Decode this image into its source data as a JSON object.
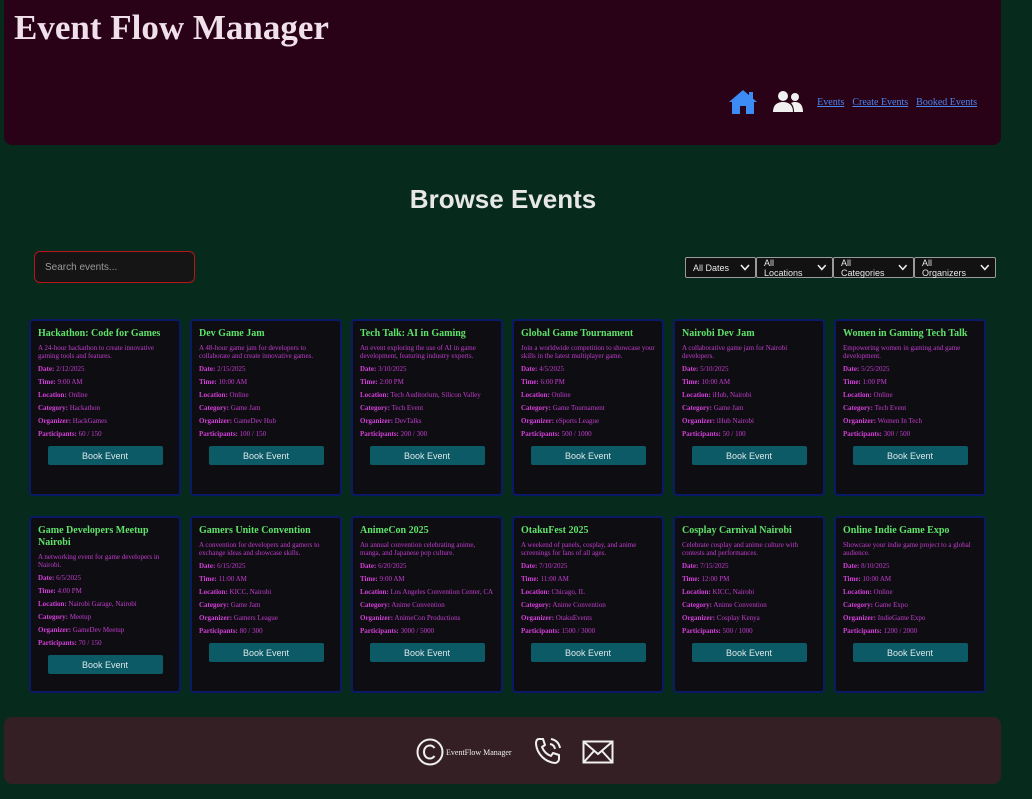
{
  "app_title": "Event Flow Manager",
  "nav": {
    "home_icon": "home-icon",
    "users_icon": "users-icon",
    "links": [
      "Events",
      "Create Events",
      "Booked Events"
    ]
  },
  "page_title": "Browse Events",
  "search": {
    "placeholder": "Search events...",
    "value": ""
  },
  "filters": [
    "All Dates",
    "All Locations",
    "All Categories",
    "All Organizers"
  ],
  "labels": {
    "date": "Date:",
    "time": "Time:",
    "location": "Location:",
    "category": "Category:",
    "organizer": "Organizer:",
    "participants": "Participants:",
    "book_button": "Book Event"
  },
  "events": [
    {
      "title": "Hackathon: Code for Games",
      "description": "A 24-hour hackathon to create innovative gaming tools and features.",
      "date": "2/12/2025",
      "time": "9:00 AM",
      "location": "Online",
      "category": "Hackathon",
      "organizer": "HackGames",
      "participants": "60 / 150"
    },
    {
      "title": "Dev Game Jam",
      "description": "A 48-hour game jam for developers to collaborate and create innovative games.",
      "date": "2/15/2025",
      "time": "10:00 AM",
      "location": "Online",
      "category": "Game Jam",
      "organizer": "GameDev Hub",
      "participants": "100 / 150"
    },
    {
      "title": "Tech Talk: AI in Gaming",
      "description": "An event exploring the use of AI in game development, featuring industry experts.",
      "date": "3/10/2025",
      "time": "2:00 PM",
      "location": "Tech Auditorium, Silicon Valley",
      "category": "Tech Event",
      "organizer": "DevTalks",
      "participants": "200 / 300"
    },
    {
      "title": "Global Game Tournament",
      "description": "Join a worldwide competition to showcase your skills in the latest multiplayer game.",
      "date": "4/5/2025",
      "time": "6:00 PM",
      "location": "Online",
      "category": "Game Tournament",
      "organizer": "eSports League",
      "participants": "500 / 1000"
    },
    {
      "title": "Nairobi Dev Jam",
      "description": "A collaborative game jam for Nairobi developers.",
      "date": "5/10/2025",
      "time": "10:00 AM",
      "location": "iHub, Nairobi",
      "category": "Game Jam",
      "organizer": "iHub Nairobi",
      "participants": "50 / 100"
    },
    {
      "title": "Women in Gaming Tech Talk",
      "description": "Empowering women in gaming and game development.",
      "date": "5/25/2025",
      "time": "1:00 PM",
      "location": "Online",
      "category": "Tech Event",
      "organizer": "Women In Tech",
      "participants": "300 / 500"
    },
    {
      "title": "Game Developers Meetup Nairobi",
      "description": "A networking event for game developers in Nairobi.",
      "date": "6/5/2025",
      "time": "4:00 PM",
      "location": "Nairobi Garage, Nairobi",
      "category": "Meetup",
      "organizer": "GameDev Meetup",
      "participants": "70 / 150"
    },
    {
      "title": "Gamers Unite Convention",
      "description": "A convention for developers and gamers to exchange ideas and showcase skills.",
      "date": "6/15/2025",
      "time": "11:00 AM",
      "location": "KICC, Nairobi",
      "category": "Game Jam",
      "organizer": "Gamers League",
      "participants": "80 / 300"
    },
    {
      "title": "AnimeCon 2025",
      "description": "An annual convention celebrating anime, manga, and Japanese pop culture.",
      "date": "6/20/2025",
      "time": "9:00 AM",
      "location": "Los Angeles Convention Center, CA",
      "category": "Anime Convention",
      "organizer": "AnimeCon Productions",
      "participants": "3000 / 5000"
    },
    {
      "title": "OtakuFest 2025",
      "description": "A weekend of panels, cosplay, and anime screenings for fans of all ages.",
      "date": "7/10/2025",
      "time": "11:00 AM",
      "location": "Chicago, IL",
      "category": "Anime Convention",
      "organizer": "OtakuEvents",
      "participants": "1500 / 3000"
    },
    {
      "title": "Cosplay Carnival Nairobi",
      "description": "Celebrate cosplay and anime culture with contests and performances.",
      "date": "7/15/2025",
      "time": "12:00 PM",
      "location": "KICC, Nairobi",
      "category": "Anime Convention",
      "organizer": "Cosplay Kenya",
      "participants": "500 / 1000"
    },
    {
      "title": "Online Indie Game Expo",
      "description": "Showcase your indie game project to a global audience.",
      "date": "8/10/2025",
      "time": "10:00 AM",
      "location": "Online",
      "category": "Game Expo",
      "organizer": "IndieGame Expo",
      "participants": "1200 / 2000"
    }
  ],
  "footer": {
    "text": "EventFlow Manager",
    "icons": [
      "copyright-icon",
      "phone-icon",
      "mail-icon"
    ]
  }
}
